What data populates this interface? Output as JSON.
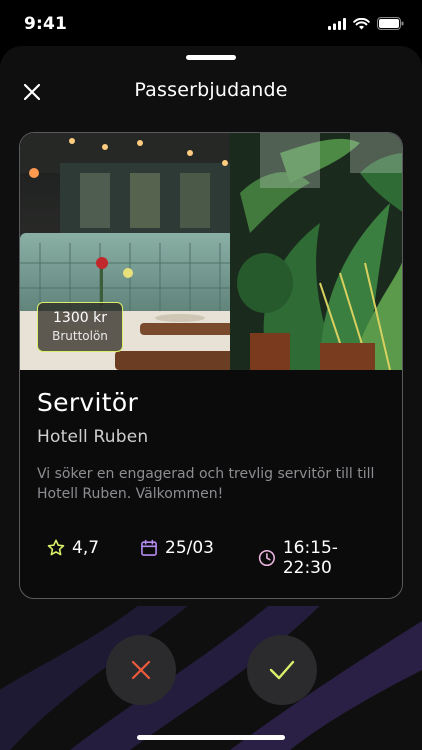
{
  "status_bar": {
    "time": "9:41"
  },
  "header": {
    "title": "Passerbjudande"
  },
  "offer": {
    "salary_amount": "1300 kr",
    "salary_label": "Bruttolön",
    "job_title": "Servitör",
    "employer": "Hotell Ruben",
    "description": "Vi söker en engagerad och trevlig servitör till till Hotell Ruben. Välkommen!",
    "rating": "4,7",
    "date": "25/03",
    "time": "16:15-22:30"
  },
  "actions": {
    "decline_icon": "close-icon",
    "accept_icon": "check-icon"
  },
  "colors": {
    "accent_green": "#d9f06a",
    "calendar_purple": "#b68cf0",
    "clock_pink": "#e9b6df",
    "decline_red": "#ef5a3c",
    "background_wave_purple": "#2a1f4a"
  }
}
